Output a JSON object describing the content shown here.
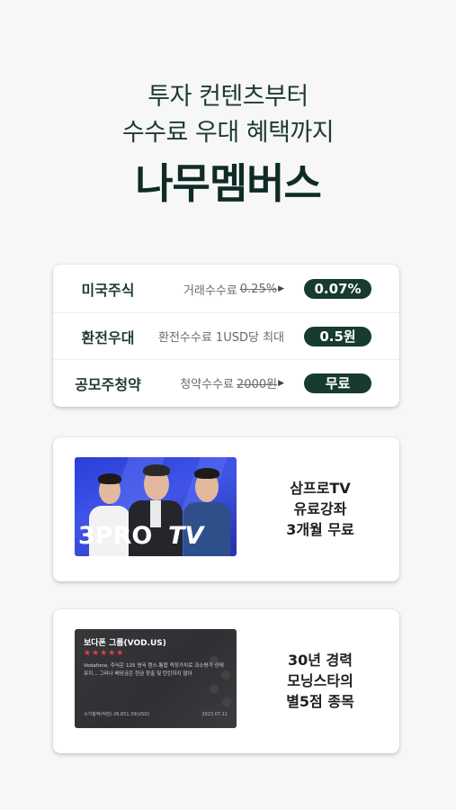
{
  "headline": {
    "line1": "투자 컨텐츠부터",
    "line2": "수수료 우대 혜택까지",
    "brand": "나무멤버스"
  },
  "rates": [
    {
      "name": "미국주식",
      "desc": "거래수수료",
      "old": "0.25%",
      "value": "0.07%"
    },
    {
      "name": "환전우대",
      "desc": "환전수수료 1USD당 최대",
      "old": "",
      "value": "0.5원"
    },
    {
      "name": "공모주청약",
      "desc": "청약수수료",
      "old": "2000원",
      "value": "무료"
    }
  ],
  "promos": [
    {
      "lines": [
        "삼프로TV",
        "유료강좌",
        "3개월 무료"
      ],
      "thumb": {
        "logo_left": "3PRO",
        "logo_right": "TV"
      }
    },
    {
      "lines": [
        "30년 경력",
        "모닝스타의",
        "별5점 종목"
      ],
      "thumb": {
        "title": "보다폰 그룹(VOD.US)",
        "stars": "★★★★★",
        "body": "Vodafone, 주식은 125 영국 텐스·통합 적정가치로 과소평가 상태 유지... 그러나 배당금은 현금 창출 및 탄탄하지 않아",
        "foot_left": "시가총액(억만)·26,651.39(USD)",
        "foot_right": "2023.07.11"
      }
    }
  ],
  "colors": {
    "accent": "#173a31",
    "background": "#f7f7f7"
  }
}
